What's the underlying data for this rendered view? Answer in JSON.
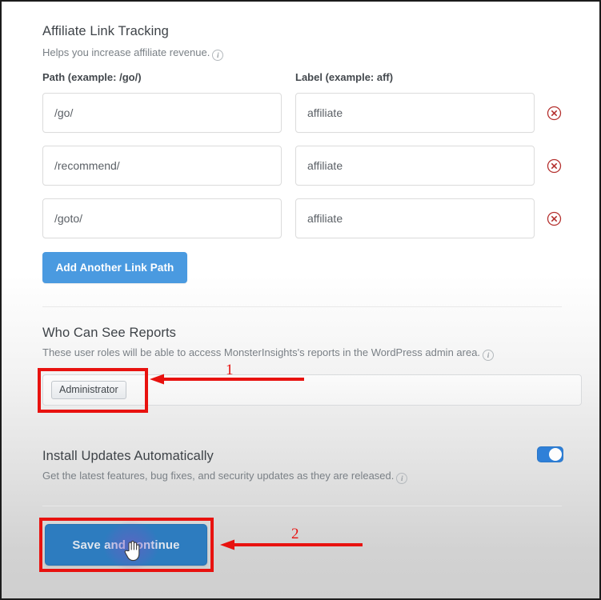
{
  "affiliate": {
    "title": "Affiliate Link Tracking",
    "description": "Helps you increase affiliate revenue.",
    "path_label": "Path (example: /go/)",
    "label_label": "Label (example: aff)",
    "rows": [
      {
        "path": "/go/",
        "label": "affiliate"
      },
      {
        "path": "/recommend/",
        "label": "affiliate"
      },
      {
        "path": "/goto/",
        "label": "affiliate"
      }
    ],
    "add_button": "Add Another Link Path",
    "path_placeholder": "/go/",
    "label_placeholder": "aff"
  },
  "reports": {
    "title": "Who Can See Reports",
    "description": "These user roles will be able to access MonsterInsights's reports in the WordPress admin area.",
    "roles": [
      "Administrator"
    ]
  },
  "updates": {
    "title": "Install Updates Automatically",
    "description": "Get the latest features, bug fixes, and security updates as they are released.",
    "toggle_state": "on"
  },
  "footer": {
    "save_button": "Save and continue"
  },
  "annotations": {
    "markers": [
      {
        "number": "1",
        "target": "administrator-role-chip"
      },
      {
        "number": "2",
        "target": "save-and-continue-button"
      }
    ]
  },
  "colors": {
    "accent_blue": "#4a9ae0",
    "save_blue": "#2d7cbf",
    "toggle_blue": "#2f80d8",
    "annotation_red": "#e8120f",
    "remove_red": "#b5312f"
  }
}
